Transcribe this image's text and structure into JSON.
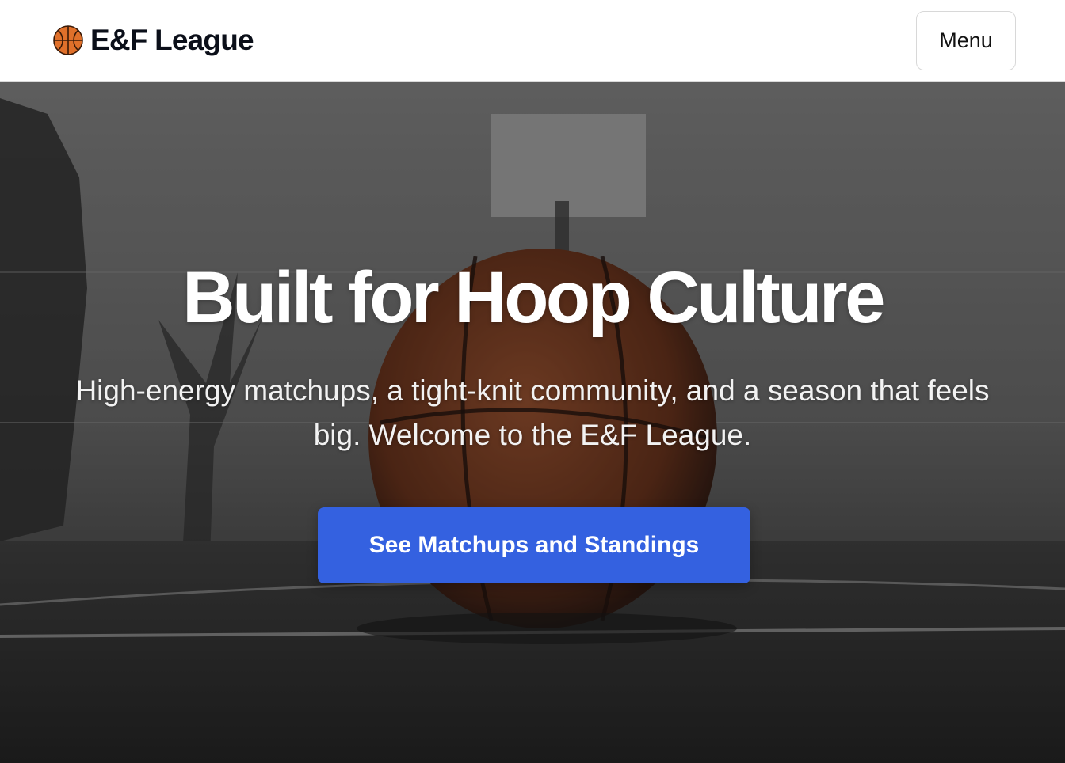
{
  "header": {
    "brand_icon": "basketball-icon",
    "brand_name": "E&F League",
    "menu_label": "Menu"
  },
  "hero": {
    "title": "Built for Hoop Culture",
    "subtitle": "High-energy matchups, a tight-knit community, and a season that feels big. Welcome to the E&F League.",
    "cta_label": "See Matchups and Standings",
    "background_image": "basketball-court-photo"
  },
  "colors": {
    "accent": "#3461e0",
    "brand_text": "#0b0f19",
    "basketball": "#e0702a"
  }
}
